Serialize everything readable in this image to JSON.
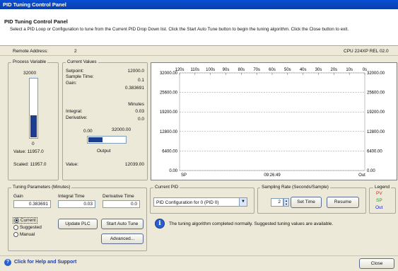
{
  "window": {
    "title": "PID Tuning Control Panel"
  },
  "header": {
    "title": "PID Tuning Control Panel",
    "description": "Select a PID Loop or Configuration to tune from the Current PID Drop Down list. Click the Start Auto Tune button to begin the tuning algorithm. Click the Close button to exit."
  },
  "remote": {
    "label": "Remote Address:",
    "value": "2",
    "cpu": "CPU 224XP REL 02.0"
  },
  "process_variable": {
    "label": "Process Variable",
    "top_value": "32000",
    "bottom_value": "0",
    "value_text": "Value: 11957.0",
    "scaled_text": "Scaled: 11957.0",
    "level": 0.374
  },
  "current_values": {
    "label": "Current Values",
    "setpoint_label": "Setpoint:",
    "setpoint": "12000.0",
    "sample_label": "Sample Time:",
    "sample": "0.1",
    "gain_label": "Gain:",
    "gain": "0.383691",
    "minutes_label": "Minutes",
    "integral_label": "Integral:",
    "integral": "0.03",
    "derivative_label": "Derivative:",
    "derivative": "0.0",
    "out_min": "0.00",
    "out_max": "32000.00",
    "output_label": "Output",
    "value_label": "Value:",
    "value": "12039.00"
  },
  "chart_data": {
    "type": "line",
    "x_ticks": [
      "120s",
      "110s",
      "100s",
      "90s",
      "80s",
      "70s",
      "60s",
      "50s",
      "40s",
      "30s",
      "20s",
      "10s",
      "0s"
    ],
    "y_ticks": [
      "32000.00",
      "25600.00",
      "19200.00",
      "12800.00",
      "6400.00",
      "0.00"
    ],
    "ylim": [
      0,
      32000
    ],
    "bottom_labels": {
      "left": "SP",
      "center": "09:26:49",
      "right": "Out"
    },
    "grid": true,
    "series": []
  },
  "tuning": {
    "label": "Tuning Parameters (Minutes)",
    "gain_label": "Gain",
    "gain": "0.383691",
    "integral_label": "Integral Time",
    "integral": "0.03",
    "derivative_label": "Derivative Time",
    "derivative": "0.0",
    "radio_current": "Current",
    "radio_suggested": "Suggested",
    "radio_manual": "Manual",
    "update_plc": "Update PLC",
    "start_auto_tune": "Start Auto Tune",
    "advanced": "Advanced..."
  },
  "current_pid": {
    "label": "Current PID",
    "selected": "PID Configuration for 0 (PID 0)"
  },
  "sampling": {
    "label": "Sampling Rate (Seconds/Sample)",
    "value": "2",
    "set_time": "Set Time",
    "resume": "Resume"
  },
  "legend": {
    "label": "Legend",
    "pv": "PV",
    "sp": "SP",
    "out": "Out",
    "pv_color": "#e02020",
    "sp_color": "#20a020",
    "out_color": "#2020d0"
  },
  "status": {
    "message": "The tuning algorithm completed normally. Suggested tuning values are available."
  },
  "footer": {
    "help": "Click for Help and Support",
    "close": "Close"
  }
}
